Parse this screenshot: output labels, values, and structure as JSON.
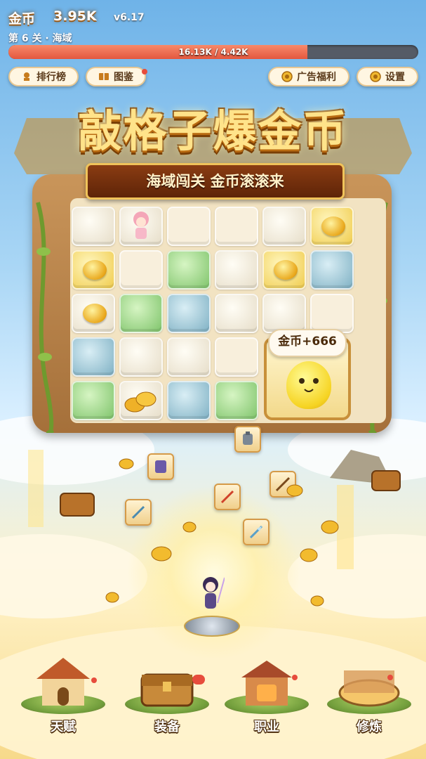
{
  "hud": {
    "coin_label": "金币",
    "coin_value": "3.95K",
    "version": "v6.17",
    "stage": "第 6 关 · 海域",
    "progress_text": "16.13K / 4.42K",
    "progress_fraction": 0.73
  },
  "top_buttons": {
    "leaderboard": "排行榜",
    "codex": "图鉴",
    "ad_reward": "广告福利",
    "settings": "设置"
  },
  "banner": {
    "title": "敲格子爆金币",
    "subtitle": "海域闯关 金币滚滚来"
  },
  "board": {
    "reward_bubble": "金币+666",
    "rows": [
      [
        "cream-char",
        "empty",
        "empty",
        "cream",
        "gold-coin"
      ],
      [
        "gold-coin",
        "empty",
        "green",
        "cream",
        "gold-coin",
        "blue"
      ],
      [
        "cream-coin",
        "green",
        "blue",
        "cream",
        "cream",
        "empty"
      ],
      [
        "blue",
        "cream",
        "cream",
        "empty",
        "pet"
      ],
      [
        "green",
        "coin-pile",
        "blue",
        "green",
        "pet"
      ]
    ]
  },
  "bottom_nav": {
    "talent": "天赋",
    "equipment": "装备",
    "job": "职业",
    "training": "修炼"
  },
  "colors": {
    "accent": "#e4573e",
    "gold": "#f0c35a",
    "brown": "#5e2408"
  }
}
